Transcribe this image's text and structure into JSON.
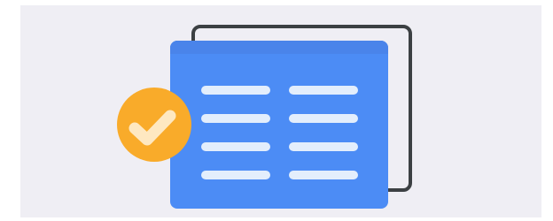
{
  "illustration": {
    "background_color": "#efeef4",
    "back_document": {
      "stroke_color": "#3c4043",
      "fill_color": "#efeef4"
    },
    "front_document": {
      "fill_color": "#4c8cf5",
      "header_color": "#4a84ea",
      "line_color": "#e3eefc",
      "columns": 2,
      "rows": 4
    },
    "check_badge": {
      "circle_color": "#f9ab2a",
      "check_color": "#fee8c1",
      "icon": "checkmark-icon"
    }
  }
}
